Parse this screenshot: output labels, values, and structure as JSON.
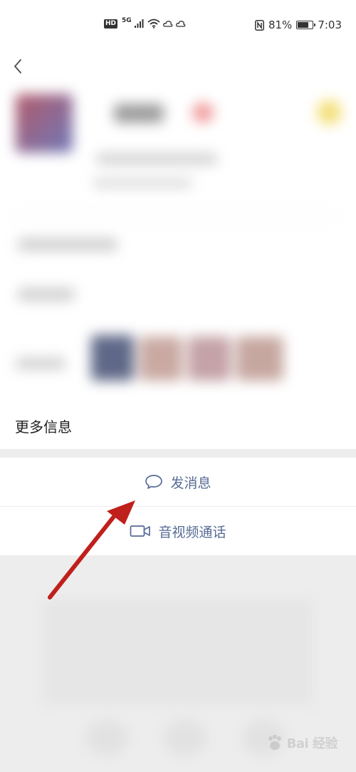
{
  "status_bar": {
    "left_badge": "HD",
    "network": "5G",
    "battery_text": "81%",
    "battery_level": 0.81,
    "time": "7:03"
  },
  "profile": {
    "more_info_label": "更多信息"
  },
  "actions": {
    "send_message_label": "发消息",
    "av_call_label": "音视频通话"
  },
  "colors": {
    "link_blue": "#576b95",
    "arrow_red": "#c0201c",
    "page_bg": "#ededed"
  },
  "icons": {
    "back": "chevron-left-icon",
    "message": "chat-bubble-icon",
    "call": "video-camera-icon"
  },
  "watermark": {
    "logo_text": "Bai 经验"
  }
}
